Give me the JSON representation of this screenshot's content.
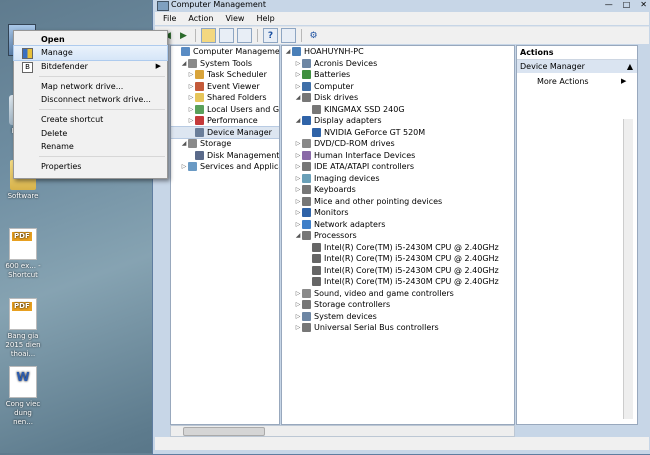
{
  "window": {
    "title": "Computer Management",
    "controls": [
      "—",
      "□",
      "✕"
    ]
  },
  "menu": [
    "File",
    "Action",
    "View",
    "Help"
  ],
  "toolbar": {
    "back_icon": "arrow-left",
    "forward_icon": "arrow-right"
  },
  "left_tree": [
    {
      "label": "Computer Management (Local",
      "level": 0,
      "exp": "",
      "icon": "computer"
    },
    {
      "label": "System Tools",
      "level": 1,
      "exp": "◢",
      "icon": "tools"
    },
    {
      "label": "Task Scheduler",
      "level": 2,
      "exp": "▷",
      "icon": "clock"
    },
    {
      "label": "Event Viewer",
      "level": 2,
      "exp": "▷",
      "icon": "event"
    },
    {
      "label": "Shared Folders",
      "level": 2,
      "exp": "▷",
      "icon": "folder"
    },
    {
      "label": "Local Users and Groups",
      "level": 2,
      "exp": "▷",
      "icon": "users"
    },
    {
      "label": "Performance",
      "level": 2,
      "exp": "▷",
      "icon": "perf"
    },
    {
      "label": "Device Manager",
      "level": 2,
      "exp": "",
      "icon": "device",
      "selected": true
    },
    {
      "label": "Storage",
      "level": 1,
      "exp": "◢",
      "icon": "storage"
    },
    {
      "label": "Disk Management",
      "level": 2,
      "exp": "",
      "icon": "disk"
    },
    {
      "label": "Services and Applications",
      "level": 1,
      "exp": "▷",
      "icon": "services"
    }
  ],
  "device_tree": [
    {
      "label": "HOAHUYNH-PC",
      "level": 0,
      "exp": "◢"
    },
    {
      "label": "Acronis Devices",
      "level": 1,
      "exp": "▷"
    },
    {
      "label": "Batteries",
      "level": 1,
      "exp": "▷"
    },
    {
      "label": "Computer",
      "level": 1,
      "exp": "▷"
    },
    {
      "label": "Disk drives",
      "level": 1,
      "exp": "◢"
    },
    {
      "label": "KINGMAX SSD 240G",
      "level": 2,
      "exp": ""
    },
    {
      "label": "Display adapters",
      "level": 1,
      "exp": "◢"
    },
    {
      "label": "NVIDIA GeForce GT 520M",
      "level": 2,
      "exp": ""
    },
    {
      "label": "DVD/CD-ROM drives",
      "level": 1,
      "exp": "▷"
    },
    {
      "label": "Human Interface Devices",
      "level": 1,
      "exp": "▷"
    },
    {
      "label": "IDE ATA/ATAPI controllers",
      "level": 1,
      "exp": "▷"
    },
    {
      "label": "Imaging devices",
      "level": 1,
      "exp": "▷"
    },
    {
      "label": "Keyboards",
      "level": 1,
      "exp": "▷"
    },
    {
      "label": "Mice and other pointing devices",
      "level": 1,
      "exp": "▷"
    },
    {
      "label": "Monitors",
      "level": 1,
      "exp": "▷"
    },
    {
      "label": "Network adapters",
      "level": 1,
      "exp": "▷"
    },
    {
      "label": "Processors",
      "level": 1,
      "exp": "◢"
    },
    {
      "label": "Intel(R) Core(TM) i5-2430M CPU @ 2.40GHz",
      "level": 2,
      "exp": ""
    },
    {
      "label": "Intel(R) Core(TM) i5-2430M CPU @ 2.40GHz",
      "level": 2,
      "exp": ""
    },
    {
      "label": "Intel(R) Core(TM) i5-2430M CPU @ 2.40GHz",
      "level": 2,
      "exp": ""
    },
    {
      "label": "Intel(R) Core(TM) i5-2430M CPU @ 2.40GHz",
      "level": 2,
      "exp": ""
    },
    {
      "label": "Sound, video and game controllers",
      "level": 1,
      "exp": "▷"
    },
    {
      "label": "Storage controllers",
      "level": 1,
      "exp": "▷"
    },
    {
      "label": "System devices",
      "level": 1,
      "exp": "▷"
    },
    {
      "label": "Universal Serial Bus controllers",
      "level": 1,
      "exp": "▷"
    }
  ],
  "actions": {
    "header": "Actions",
    "section": "Device Manager",
    "item": "More Actions"
  },
  "context_menu": [
    {
      "label": "Open",
      "bold": true
    },
    {
      "label": "Manage",
      "highlight": true,
      "icon": "shield"
    },
    {
      "label": "Bitdefender",
      "icon": "bitdefender",
      "submenu": true
    },
    {
      "sep": true
    },
    {
      "label": "Map network drive..."
    },
    {
      "label": "Disconnect network drive..."
    },
    {
      "sep": true
    },
    {
      "label": "Create shortcut"
    },
    {
      "label": "Delete"
    },
    {
      "label": "Rename"
    },
    {
      "sep": true
    },
    {
      "label": "Properties"
    }
  ],
  "desktop_icons": [
    {
      "label": "Com",
      "type": "computer"
    },
    {
      "label": "Recyc",
      "type": "recycle"
    },
    {
      "label": "Software",
      "type": "folder"
    },
    {
      "label": "600 ex... - Shortcut",
      "type": "pdf"
    },
    {
      "label": "Bang gia 2015 dien thoai...",
      "type": "pdf"
    },
    {
      "label": "Cong viec dung nen...",
      "type": "doc"
    }
  ]
}
